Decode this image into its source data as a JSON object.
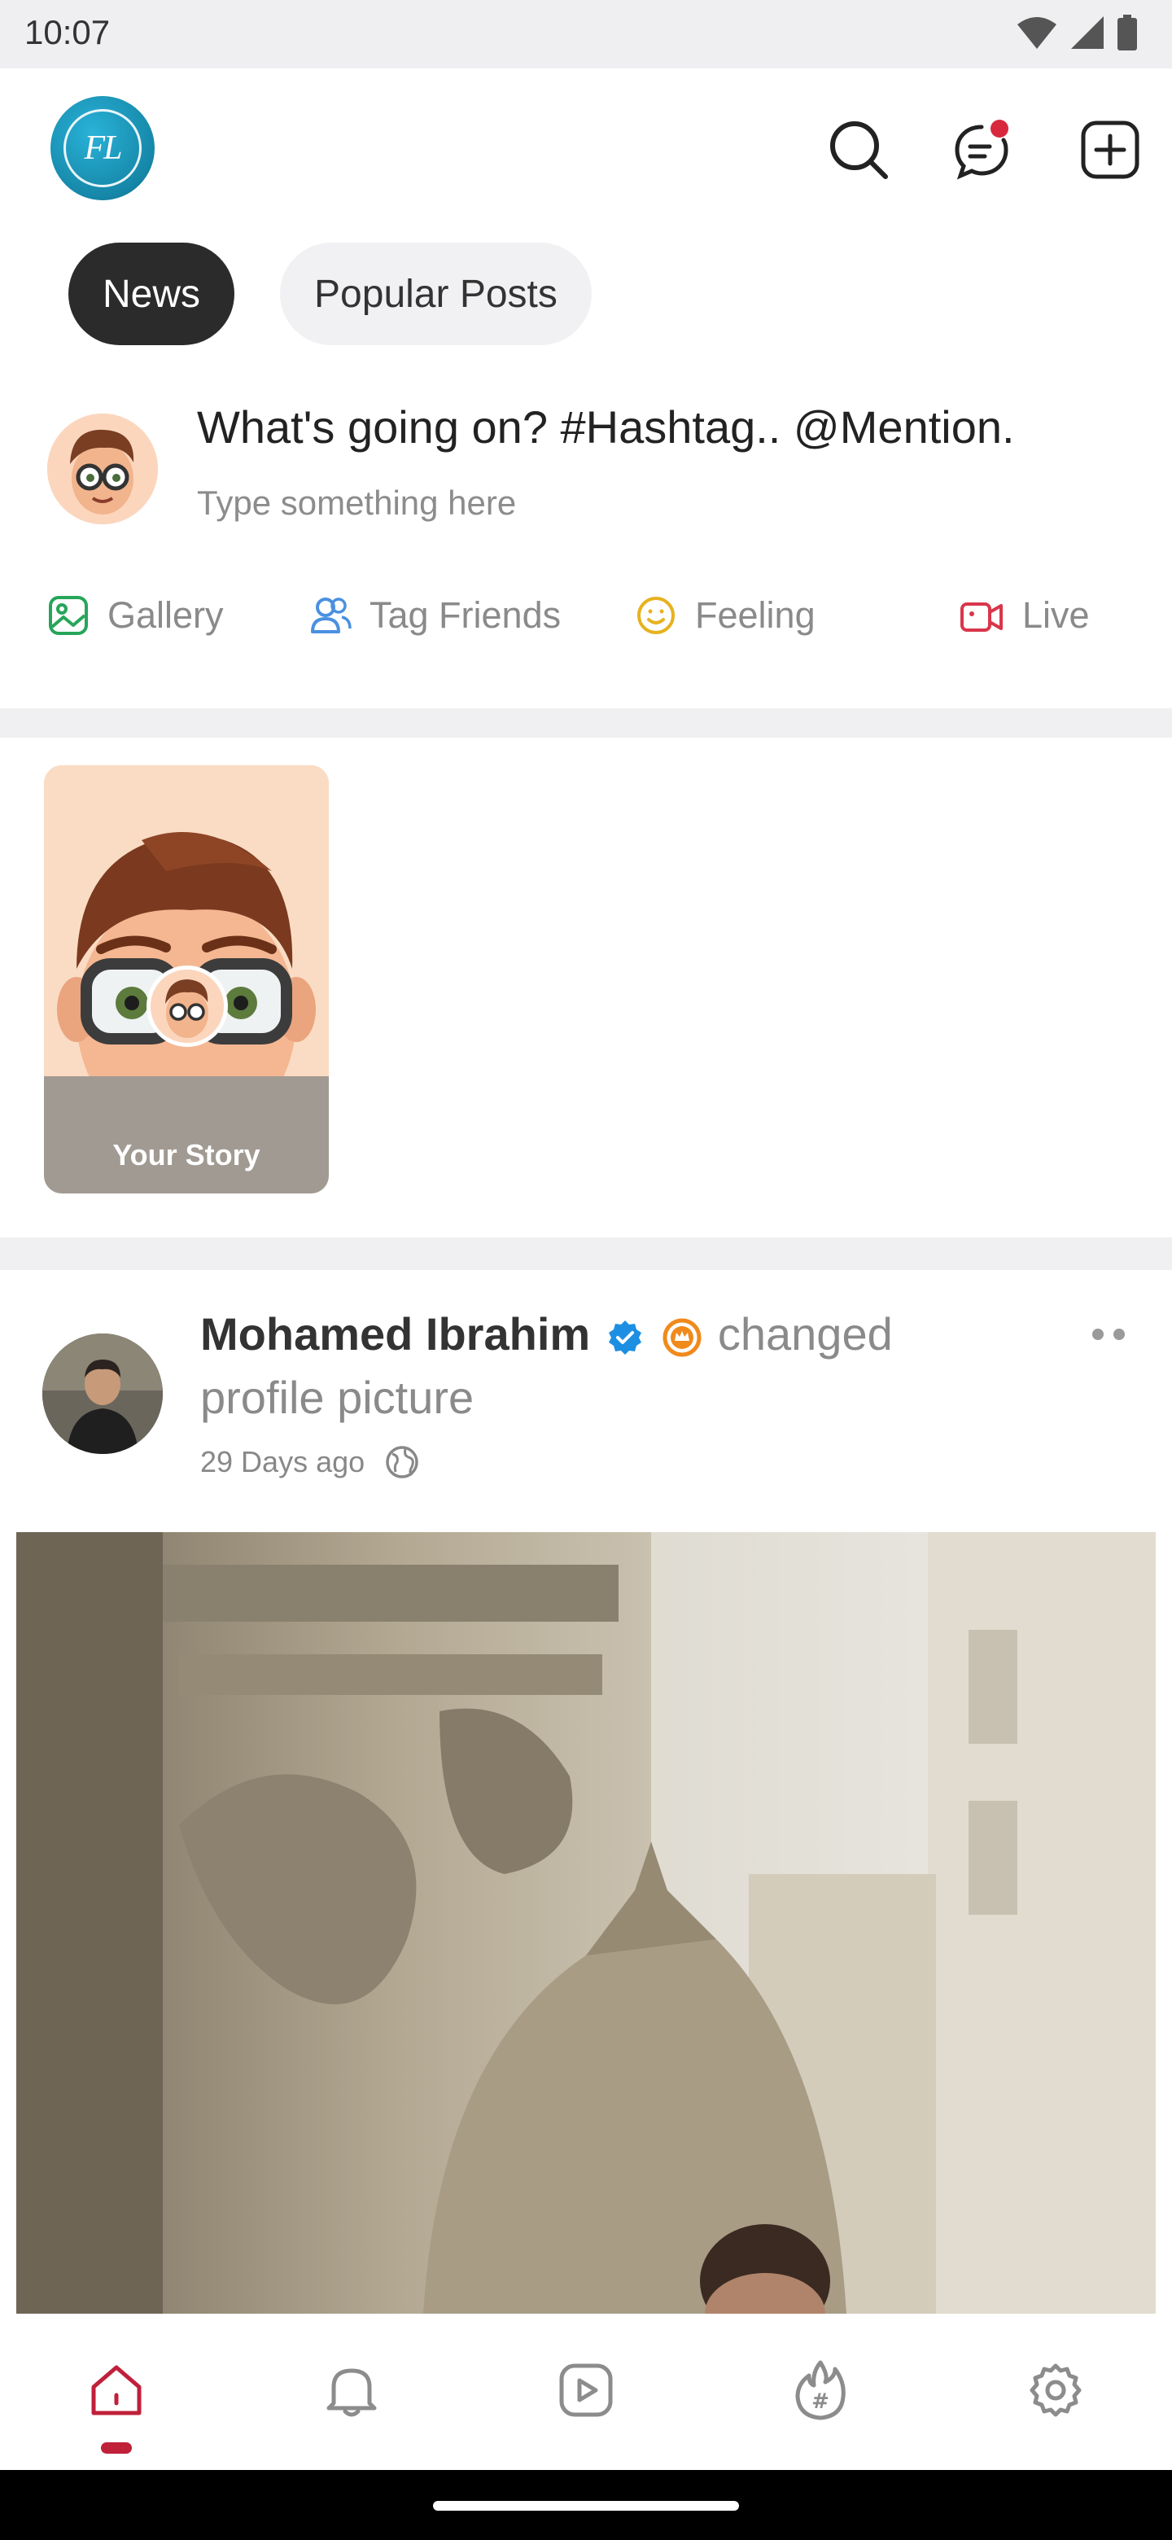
{
  "status_bar": {
    "time": "10:07"
  },
  "app": {
    "logo_text": "FL"
  },
  "tabs": [
    {
      "label": "News",
      "active": true
    },
    {
      "label": "Popular Posts",
      "active": false
    }
  ],
  "composer": {
    "prompt": "What's going on? #Hashtag.. @Mention.",
    "hint": "Type something here",
    "actions": [
      {
        "label": "Gallery",
        "icon": "gallery-icon",
        "color": "#27a55a"
      },
      {
        "label": "Tag Friends",
        "icon": "tag-friends-icon",
        "color": "#4a90e2"
      },
      {
        "label": "Feeling",
        "icon": "feeling-icon",
        "color": "#e7b21f"
      },
      {
        "label": "Live",
        "icon": "live-icon",
        "color": "#d9364a"
      }
    ]
  },
  "stories": {
    "your_story_label": "Your Story"
  },
  "post": {
    "author": "Mohamed Ibrahim",
    "action_text": "changed profile picture",
    "time": "29 Days ago",
    "verified_color": "#1d8fe3",
    "pro_badge_color": "#f08a1c"
  },
  "bottom_nav": {
    "items": [
      "home-icon",
      "notifications-icon",
      "videos-icon",
      "trending-hashtag-icon",
      "settings-icon"
    ],
    "active_index": 0,
    "accent": "#c0203a"
  }
}
